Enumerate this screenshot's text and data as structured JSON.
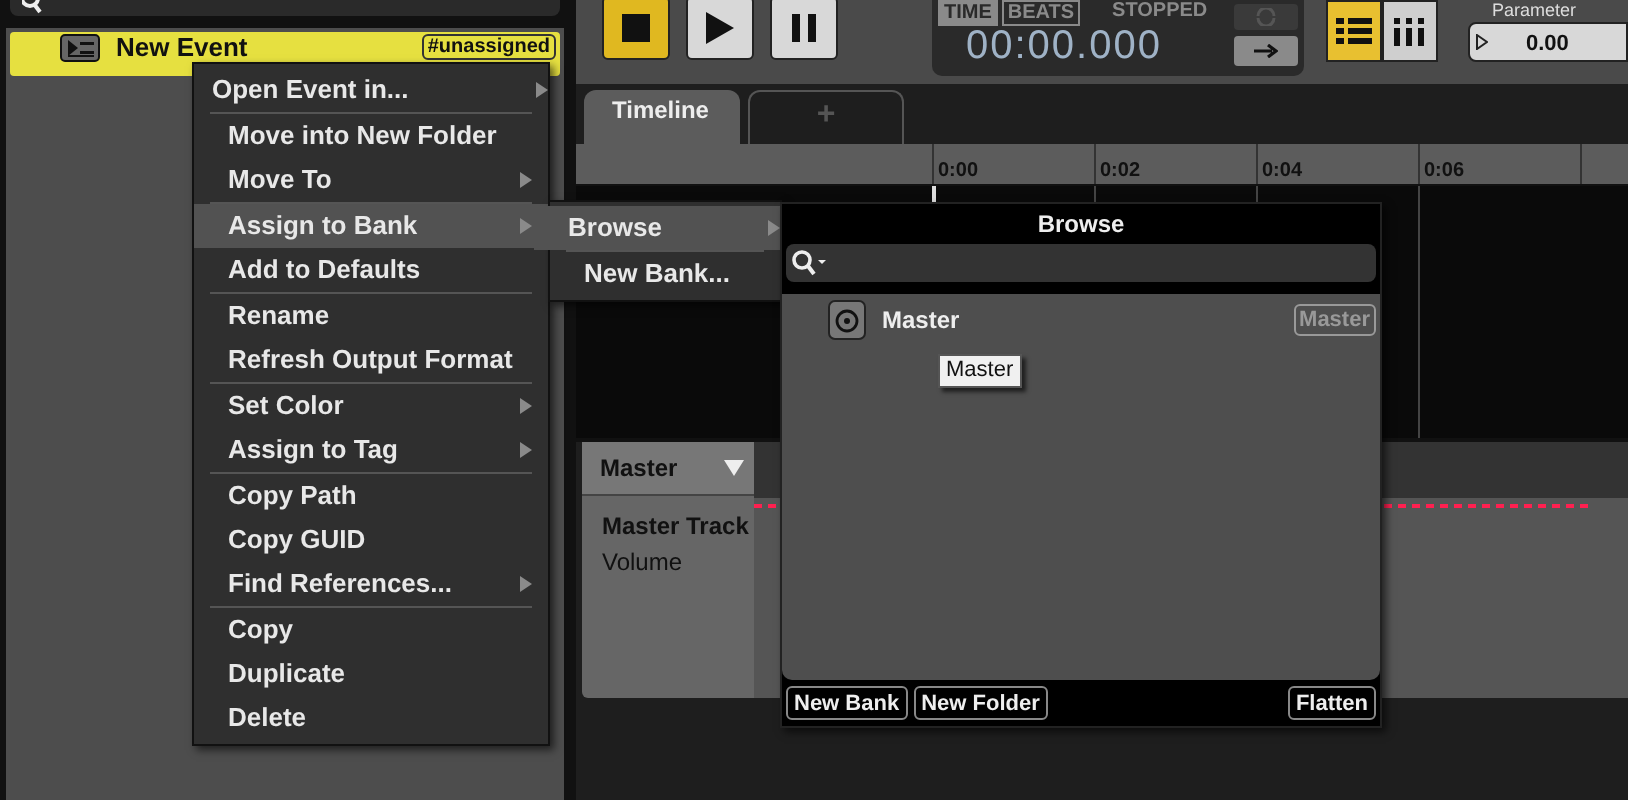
{
  "event_list": {
    "item": {
      "name": "New Event",
      "tag": "#unassigned",
      "selected": true
    }
  },
  "transport": {
    "buttons": [
      {
        "kind": "stop",
        "on": true
      },
      {
        "kind": "play",
        "on": false
      },
      {
        "kind": "pause",
        "on": false
      }
    ],
    "modes": [
      {
        "label": "TIME",
        "selected": true
      },
      {
        "label": "BEATS",
        "selected": false
      }
    ],
    "status": "STOPPED",
    "time": "00:00.000",
    "view_buttons": [
      {
        "kind": "list",
        "selected": true
      },
      {
        "kind": "grid",
        "selected": false
      }
    ],
    "parameter": {
      "label": "Parameter",
      "value": "0.00",
      "level": 0
    }
  },
  "tabs": [
    {
      "label": "Timeline",
      "selected": true
    },
    {
      "label": "+",
      "selected": false
    }
  ],
  "ruler": [
    "0:00",
    "0:02",
    "0:04",
    "0:06"
  ],
  "track": {
    "name": "Master",
    "title": "Master Track",
    "property": "Volume"
  },
  "context_menu": {
    "groups": [
      [
        {
          "label": "Open Event in...",
          "submenu": true,
          "highlighted": false
        }
      ],
      [
        {
          "label": "Move into New Folder",
          "submenu": false,
          "highlighted": false
        },
        {
          "label": "Move To",
          "submenu": true,
          "highlighted": false
        }
      ],
      [
        {
          "label": "Assign to Bank",
          "submenu": true,
          "highlighted": true
        },
        {
          "label": "Add to Defaults",
          "submenu": false,
          "highlighted": false
        }
      ],
      [
        {
          "label": "Rename",
          "submenu": false,
          "highlighted": false
        },
        {
          "label": "Refresh Output Format",
          "submenu": false,
          "highlighted": false
        }
      ],
      [
        {
          "label": "Set Color",
          "submenu": true,
          "highlighted": false
        },
        {
          "label": "Assign to Tag",
          "submenu": true,
          "highlighted": false
        }
      ],
      [
        {
          "label": "Copy Path",
          "submenu": false,
          "highlighted": false
        },
        {
          "label": "Copy GUID",
          "submenu": false,
          "highlighted": false
        },
        {
          "label": "Find References...",
          "submenu": true,
          "highlighted": false
        }
      ],
      [
        {
          "label": "Copy",
          "submenu": false,
          "highlighted": false
        },
        {
          "label": "Duplicate",
          "submenu": false,
          "highlighted": false
        },
        {
          "label": "Delete",
          "submenu": false,
          "highlighted": false
        }
      ]
    ]
  },
  "submenu": {
    "groups": [
      [
        {
          "label": "Browse",
          "submenu": true,
          "highlighted": true
        }
      ],
      [
        {
          "label": "New Bank...",
          "submenu": false,
          "highlighted": false
        }
      ]
    ]
  },
  "browser": {
    "title": "Browse",
    "items": [
      {
        "name": "Master",
        "tag": "Master"
      }
    ],
    "tooltip": "Master",
    "buttons": [
      "New Bank",
      "New Folder",
      "Flatten"
    ]
  }
}
